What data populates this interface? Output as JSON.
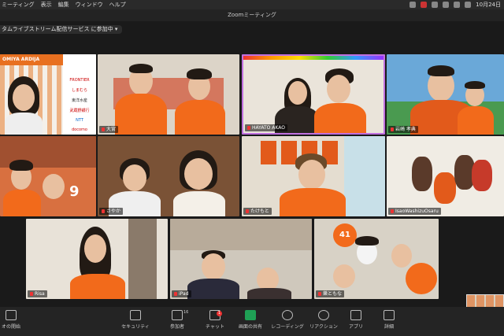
{
  "menubar": {
    "items": [
      "ミーティング",
      "表示",
      "編集",
      "ウィンドウ",
      "ヘルプ"
    ],
    "clock": "10月24日"
  },
  "window": {
    "title": "Zoomミーティング"
  },
  "stream": {
    "label": "タムライブストリーム配信サービス に参加中 ▾"
  },
  "participants": [
    {
      "name": "",
      "banner": "OMIYA ARDIJA",
      "sponsors": [
        "FRONTIER",
        "しまむら",
        "東洋水産",
        "武蔵野銀行",
        "NTT",
        "docomo"
      ]
    },
    {
      "name": "大宮"
    },
    {
      "name": "HAYATO AKAO"
    },
    {
      "name": "岩崎 孝典"
    },
    {
      "name": "",
      "jersey_number": "9"
    },
    {
      "name": "さやか"
    },
    {
      "name": ""
    },
    {
      "name": "たけもと"
    },
    {
      "name": "IsaoWashizuOsaru"
    },
    {
      "name": "Risa"
    },
    {
      "name": "iPad"
    },
    {
      "name": "樂ともな",
      "jersey_number": "41"
    }
  ],
  "toolbar": {
    "video": "オの開始",
    "security": "セキュリティ",
    "participants": "参加者",
    "participants_count": "16",
    "chat": "チャット",
    "chat_badge": "1",
    "share": "画面の共有",
    "record": "レコーディング",
    "reactions": "リアクション",
    "apps": "アプリ",
    "details": "詳細"
  }
}
